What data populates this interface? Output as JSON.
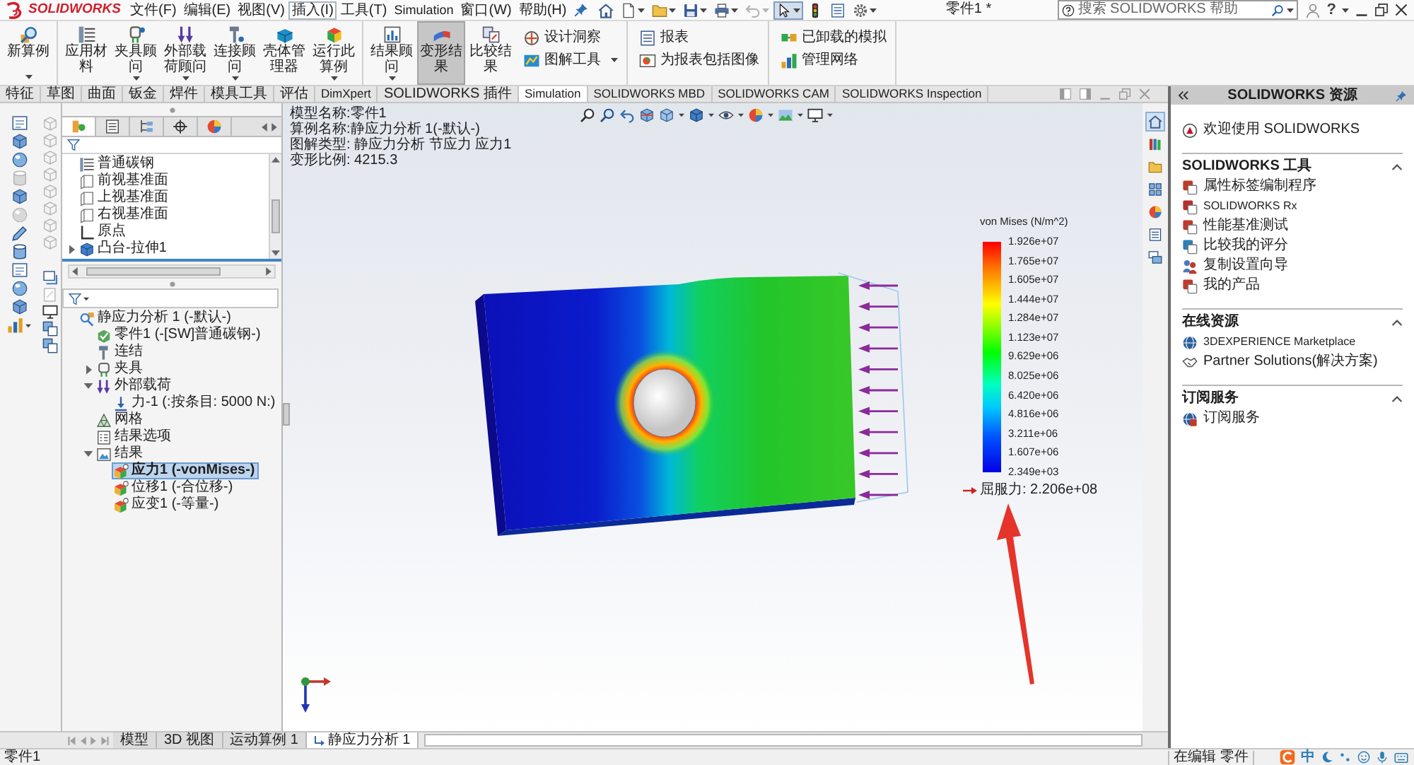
{
  "title_bar": {
    "logo_text": "SOLIDWORKS",
    "menus": [
      {
        "label": "文件(F)",
        "hovered": false
      },
      {
        "label": "编辑(E)",
        "hovered": false
      },
      {
        "label": "视图(V)",
        "hovered": false
      },
      {
        "label": "插入(I)",
        "hovered": true
      },
      {
        "label": "工具(T)",
        "hovered": false
      },
      {
        "label": "Simulation",
        "hovered": false
      },
      {
        "label": "窗口(W)",
        "hovered": false
      },
      {
        "label": "帮助(H)",
        "hovered": false
      }
    ],
    "quick_access": [
      {
        "kind": "home",
        "dropdown": false,
        "pressed": false,
        "disabled": false
      },
      {
        "kind": "new",
        "dropdown": true,
        "pressed": false,
        "disabled": false
      },
      {
        "kind": "open",
        "dropdown": true,
        "pressed": false,
        "disabled": false
      },
      {
        "kind": "save",
        "dropdown": true,
        "pressed": false,
        "disabled": false
      },
      {
        "kind": "print",
        "dropdown": true,
        "pressed": false,
        "disabled": false
      },
      {
        "kind": "undo",
        "dropdown": true,
        "pressed": false,
        "disabled": true
      },
      {
        "kind": "select",
        "dropdown": true,
        "pressed": true,
        "disabled": false
      },
      {
        "kind": "rebuild",
        "dropdown": false,
        "pressed": false,
        "disabled": false
      },
      {
        "kind": "properties",
        "dropdown": false,
        "pressed": false,
        "disabled": false
      },
      {
        "kind": "options",
        "dropdown": true,
        "pressed": false,
        "disabled": false
      }
    ],
    "document_title": "零件1 *",
    "search": {
      "placeholder": "搜索 SOLIDWORKS 帮助"
    },
    "help_label": "?"
  },
  "ribbon": {
    "groups": [
      {
        "buttons": [
          {
            "label": "新算例",
            "kind": "new_study",
            "compact": false,
            "dropdown": true,
            "pressed": false
          }
        ]
      },
      {
        "buttons": [
          {
            "label": "应用材料",
            "kind": "apply_material",
            "compact": false,
            "dropdown": false,
            "pressed": false
          },
          {
            "label": "夹具顾问",
            "kind": "fixtures_advisor",
            "compact": false,
            "dropdown": true,
            "pressed": false
          },
          {
            "label": "外部载荷顾问",
            "kind": "loads_advisor",
            "compact": false,
            "dropdown": true,
            "pressed": false
          },
          {
            "label": "连接顾问",
            "kind": "connections_advisor",
            "compact": false,
            "dropdown": true,
            "pressed": false
          },
          {
            "label": "壳体管理器",
            "kind": "shell_manager",
            "compact": false,
            "dropdown": false,
            "pressed": false
          },
          {
            "label": "运行此算例",
            "kind": "run_study",
            "compact": false,
            "dropdown": true,
            "pressed": false
          }
        ]
      },
      {
        "buttons": [
          {
            "label": "结果顾问",
            "kind": "results_advisor",
            "compact": false,
            "dropdown": true,
            "pressed": false
          },
          {
            "label": "变形结果",
            "kind": "deformed_result",
            "compact": false,
            "dropdown": false,
            "pressed": true
          },
          {
            "label": "比较结果",
            "kind": "compare_results",
            "compact": false,
            "dropdown": false,
            "pressed": false
          },
          {
            "label": "设计洞察",
            "kind": "design_insight",
            "compact": true,
            "dropdown": false,
            "pressed": false
          },
          {
            "label": "图解工具",
            "kind": "plot_tools",
            "compact": true,
            "dropdown": true,
            "pressed": false
          }
        ]
      },
      {
        "buttons": [
          {
            "label": "报表",
            "kind": "report",
            "compact": true,
            "dropdown": false,
            "pressed": false
          },
          {
            "label": "为报表包括图像",
            "kind": "include_image",
            "compact": true,
            "dropdown": false,
            "pressed": false
          }
        ]
      },
      {
        "buttons": [
          {
            "label": "已卸载的模拟",
            "kind": "unloaded",
            "compact": true,
            "dropdown": false,
            "pressed": false
          },
          {
            "label": "管理网络",
            "kind": "manage_network",
            "compact": true,
            "dropdown": false,
            "pressed": false
          }
        ]
      }
    ]
  },
  "command_tabs": [
    {
      "label": "特征",
      "selected": false
    },
    {
      "label": "草图",
      "selected": false
    },
    {
      "label": "曲面",
      "selected": false
    },
    {
      "label": "钣金",
      "selected": false
    },
    {
      "label": "焊件",
      "selected": false
    },
    {
      "label": "模具工具",
      "selected": false
    },
    {
      "label": "评估",
      "selected": false
    },
    {
      "label": "DimXpert",
      "selected": false
    },
    {
      "label": "SOLIDWORKS 插件",
      "selected": false
    },
    {
      "label": "Simulation",
      "selected": true
    },
    {
      "label": "SOLIDWORKS MBD",
      "selected": false
    },
    {
      "label": "SOLIDWORKS CAM",
      "selected": false
    },
    {
      "label": "SOLIDWORKS Inspection",
      "selected": false
    }
  ],
  "left_toolbar": {
    "primary": [
      {
        "kind": "sheet",
        "disabled": false,
        "dropdown": false
      },
      {
        "kind": "cube",
        "disabled": false,
        "dropdown": false
      },
      {
        "kind": "sphere",
        "disabled": false,
        "dropdown": false
      },
      {
        "kind": "cylinder",
        "disabled": true,
        "dropdown": false
      },
      {
        "kind": "cube",
        "disabled": false,
        "dropdown": false
      },
      {
        "kind": "sphere",
        "disabled": true,
        "dropdown": false
      },
      {
        "kind": "pencil",
        "disabled": false,
        "dropdown": false
      },
      {
        "kind": "cylinder",
        "disabled": false,
        "dropdown": false
      },
      {
        "kind": "sheet",
        "disabled": false,
        "dropdown": false
      },
      {
        "kind": "sphere",
        "disabled": false,
        "dropdown": false
      },
      {
        "kind": "cube",
        "disabled": false,
        "dropdown": false
      },
      {
        "kind": "chart",
        "disabled": false,
        "dropdown": true
      }
    ],
    "secondary_groups": [
      {
        "items": [
          {
            "kind": "view",
            "disabled": true
          },
          {
            "kind": "view",
            "disabled": true
          },
          {
            "kind": "view",
            "disabled": true
          },
          {
            "kind": "view",
            "disabled": true
          },
          {
            "kind": "view",
            "disabled": true
          },
          {
            "kind": "view",
            "disabled": true
          },
          {
            "kind": "view",
            "disabled": true
          },
          {
            "kind": "view",
            "disabled": true
          }
        ]
      },
      {
        "items": [
          {
            "kind": "window",
            "disabled": false
          },
          {
            "kind": "note",
            "disabled": true
          },
          {
            "kind": "monitor",
            "disabled": false
          },
          {
            "kind": "stack",
            "disabled": false
          },
          {
            "kind": "stack",
            "disabled": false
          }
        ]
      }
    ]
  },
  "feature_manager": {
    "panel_tabs": [
      {
        "kind": "feature_tab",
        "selected": true
      },
      {
        "kind": "property_tab",
        "selected": false
      },
      {
        "kind": "configuration_tab",
        "selected": false
      },
      {
        "kind": "dimxpert_tab",
        "selected": false
      },
      {
        "kind": "display_tab",
        "selected": false
      }
    ],
    "feature_tree": [
      {
        "label": "普通碳钢",
        "kind": "material",
        "selected": false
      },
      {
        "label": "前视基准面",
        "kind": "plane",
        "selected": false
      },
      {
        "label": "上视基准面",
        "kind": "plane",
        "selected": false
      },
      {
        "label": "右视基准面",
        "kind": "plane",
        "selected": false
      },
      {
        "label": "原点",
        "kind": "origin",
        "selected": false
      },
      {
        "label": "凸台-拉伸1",
        "kind": "extrude",
        "expanded": false,
        "selected": false
      }
    ],
    "simulation_tree": [
      {
        "label": "静应力分析 1 (-默认-)",
        "kind": "study",
        "selected": false,
        "children": [
          {
            "label": "零件1 (-[SW]普通碳钢-)",
            "kind": "part",
            "selected": false
          },
          {
            "label": "连结",
            "kind": "connections",
            "selected": false
          },
          {
            "label": "夹具",
            "kind": "fixtures",
            "expanded": false,
            "selected": false
          },
          {
            "label": "外部载荷",
            "kind": "loads",
            "expanded": true,
            "selected": false,
            "children": [
              {
                "label": "力-1 (:按条目: 5000 N:)",
                "kind": "force",
                "selected": false
              }
            ]
          },
          {
            "label": "网格",
            "kind": "mesh",
            "selected": false
          },
          {
            "label": "结果选项",
            "kind": "result_options",
            "selected": false
          },
          {
            "label": "结果",
            "kind": "results",
            "expanded": true,
            "selected": false,
            "children": [
              {
                "label": "应力1 (-vonMises-)",
                "kind": "result_plot",
                "selected": true,
                "active": true
              },
              {
                "label": "位移1 (-合位移-)",
                "kind": "result_plot",
                "selected": false,
                "active": false
              },
              {
                "label": "应变1 (-等量-)",
                "kind": "result_plot",
                "selected": false,
                "active": false
              }
            ]
          }
        ]
      }
    ]
  },
  "graphics": {
    "plot_info": [
      "模型名称:零件1",
      "算例名称:静应力分析 1(-默认-)",
      "图解类型: 静应力分析 节应力 应力1",
      "变形比例: 4215.3"
    ],
    "legend": {
      "title": "von Mises (N/m^2)",
      "ticks": [
        "1.926e+07",
        "1.765e+07",
        "1.605e+07",
        "1.444e+07",
        "1.284e+07",
        "1.123e+07",
        "9.629e+06",
        "8.025e+06",
        "6.420e+06",
        "4.816e+06",
        "3.211e+06",
        "1.607e+06",
        "2.349e+03"
      ],
      "yield_label": "屈服力: 2.206e+08"
    }
  },
  "task_pane_tabs": [
    {
      "kind": "resources",
      "selected": true
    },
    {
      "kind": "library",
      "selected": false
    },
    {
      "kind": "explorer",
      "selected": false
    },
    {
      "kind": "palette",
      "selected": false
    },
    {
      "kind": "appearances",
      "selected": false
    },
    {
      "kind": "custom_properties",
      "selected": false
    },
    {
      "kind": "forum",
      "selected": false
    }
  ],
  "task_pane": {
    "title": "SOLIDWORKS 资源",
    "welcome": "欢迎使用 SOLIDWORKS",
    "sections": [
      {
        "title": "SOLIDWORKS 工具",
        "expanded": true,
        "items": [
          {
            "label": "属性标签编制程序",
            "kind": "tool_tag"
          },
          {
            "label": "SOLIDWORKS Rx",
            "kind": "tool_rx"
          },
          {
            "label": "性能基准测试",
            "kind": "tool_benchmark"
          },
          {
            "label": "比较我的评分",
            "kind": "tool_compare"
          },
          {
            "label": "复制设置向导",
            "kind": "tool_copy"
          },
          {
            "label": "我的产品",
            "kind": "tool_products"
          }
        ]
      },
      {
        "title": "在线资源",
        "expanded": true,
        "items": [
          {
            "label": "3DEXPERIENCE Marketplace",
            "kind": "marketplace"
          },
          {
            "label": "Partner Solutions(解决方案)",
            "kind": "partner"
          }
        ]
      },
      {
        "title": "订阅服务",
        "expanded": true,
        "items": [
          {
            "label": "订阅服务",
            "kind": "subscription"
          }
        ]
      }
    ]
  },
  "bottom_tabs": [
    {
      "label": "模型",
      "kind": "model",
      "selected": false
    },
    {
      "label": "3D 视图",
      "kind": "view",
      "selected": false
    },
    {
      "label": "运动算例 1",
      "kind": "motion",
      "selected": false
    },
    {
      "label": "静应力分析 1",
      "kind": "study",
      "selected": true
    }
  ],
  "status_bar": {
    "document": "零件1",
    "mode": "在编辑 零件",
    "input_method": "中"
  }
}
